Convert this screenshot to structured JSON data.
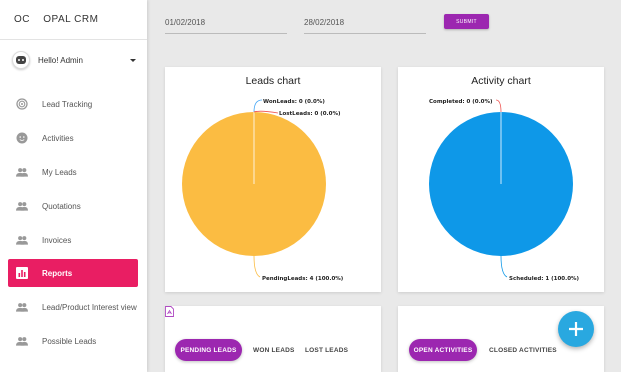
{
  "app": {
    "short": "OC",
    "name": "OPAL CRM"
  },
  "user": {
    "greeting": "Hello! Admin"
  },
  "sidebar": {
    "items": [
      {
        "label": "Lead Tracking",
        "icon": "target-icon"
      },
      {
        "label": "Activities",
        "icon": "face-icon"
      },
      {
        "label": "My Leads",
        "icon": "people-icon"
      },
      {
        "label": "Quotations",
        "icon": "people-icon"
      },
      {
        "label": "Invoices",
        "icon": "people-icon"
      },
      {
        "label": "Reports",
        "icon": "bar-chart-icon",
        "active": true
      },
      {
        "label": "Lead/Product Interest view",
        "icon": "people-icon"
      },
      {
        "label": "Possible Leads",
        "icon": "people-icon"
      }
    ]
  },
  "filters": {
    "start_date": "01/02/2018",
    "end_date": "28/02/2018",
    "submit_label": "SUBMIT"
  },
  "leads_chart": {
    "title": "Leads chart",
    "labels": {
      "won": "WonLeads: 0 (0.0%)",
      "lost": "LostLeads: 0 (0.0%)",
      "pending": "PendingLeads: 4 (100.0%)"
    }
  },
  "activity_chart": {
    "title": "Activity chart",
    "labels": {
      "completed": "Completed: 0 (0.0%)",
      "scheduled": "Scheduled: 1 (100.0%)"
    }
  },
  "chart_data": [
    {
      "type": "pie",
      "title": "Leads chart",
      "categories": [
        "WonLeads",
        "LostLeads",
        "PendingLeads"
      ],
      "values": [
        0,
        0,
        4
      ],
      "colors": [
        "#42a5f5",
        "#ef5350",
        "#fbbc42"
      ]
    },
    {
      "type": "pie",
      "title": "Activity chart",
      "categories": [
        "Completed",
        "Scheduled"
      ],
      "values": [
        0,
        1
      ],
      "colors": [
        "#ef5350",
        "#0e98e8"
      ]
    }
  ],
  "leads_tabs": {
    "pending": "PENDING LEADS",
    "won": "WON LEADS",
    "lost": "LOST LEADS"
  },
  "activity_tabs": {
    "open": "OPEN ACTIVITIES",
    "closed": "CLOSED ACTIVITIES"
  },
  "colors": {
    "accent": "#e91e63",
    "purple": "#9c27b0",
    "fab": "#29a8e0"
  }
}
